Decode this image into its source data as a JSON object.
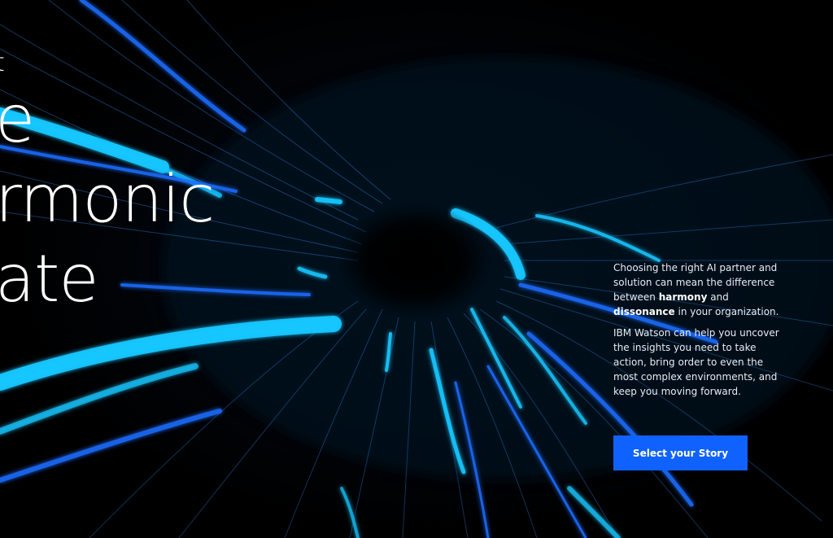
{
  "hero": {
    "headline_lines": [
      "t",
      "e",
      "rmonic",
      "ate"
    ]
  },
  "copy": {
    "p1_a": "Choosing the right AI partner and solution can mean the difference between ",
    "p1_strong1": "harmony",
    "p1_b": " and ",
    "p1_strong2": "dissonance",
    "p1_c": " in your organization.",
    "p2": "IBM Watson can help you uncover the insights you need to take action, bring order to even the most complex environments, and keep you moving forward."
  },
  "cta": {
    "label": "Select your Story"
  },
  "colors": {
    "accent": "#0f62fe",
    "streak_cyan": "#16c6ff",
    "streak_blue": "#1a6dff",
    "background": "#000000"
  }
}
